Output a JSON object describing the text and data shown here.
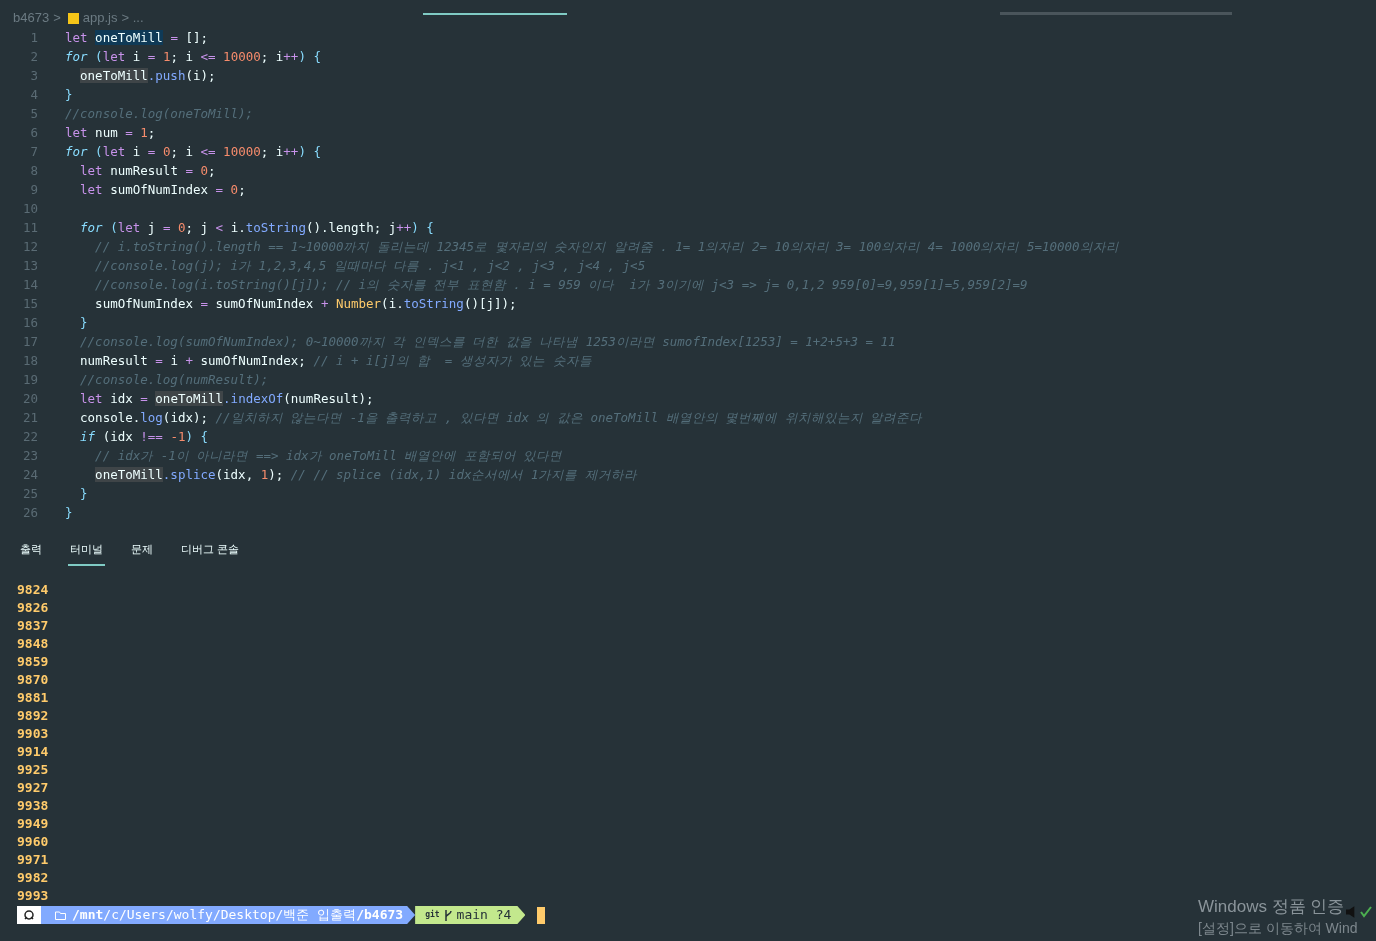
{
  "breadcrumb": {
    "folder": "b4673",
    "separator": ">",
    "file": "app.js",
    "more": "> ..."
  },
  "editor": {
    "lines": [
      {
        "number": "1",
        "tokens": [
          {
            "text": "let",
            "kind": "k"
          },
          {
            "text": " oneToMill",
            "kind": "s"
          },
          {
            "text": " =",
            "kind": "o"
          },
          {
            "text": " [];",
            "kind": "v"
          }
        ]
      },
      {
        "number": "2",
        "tokens": [
          {
            "text": "for",
            "kind": "c"
          },
          {
            "text": " (",
            "kind": "p"
          },
          {
            "text": "let",
            "kind": "k"
          },
          {
            "text": " i ",
            "kind": "v"
          },
          {
            "text": "=",
            "kind": "o"
          },
          {
            "text": " 1",
            "kind": "n"
          },
          {
            "text": "; i ",
            "kind": "v"
          },
          {
            "text": "<=",
            "kind": "o"
          },
          {
            "text": " 10000",
            "kind": "n"
          },
          {
            "text": "; i",
            "kind": "v"
          },
          {
            "text": "++",
            "kind": "o"
          },
          {
            "text": ") {",
            "kind": "p"
          }
        ]
      },
      {
        "number": "3",
        "tokens": [
          {
            "text": "  oneToMill",
            "kind": "h"
          },
          {
            "text": ".push",
            "kind": "f"
          },
          {
            "text": "(i);",
            "kind": "v"
          }
        ]
      },
      {
        "number": "4",
        "tokens": [
          {
            "text": "}",
            "kind": "p"
          }
        ]
      },
      {
        "number": "5",
        "tokens": [
          {
            "text": "//console.log(oneToMill);",
            "kind": "m"
          }
        ]
      },
      {
        "number": "6",
        "tokens": [
          {
            "text": "let",
            "kind": "k"
          },
          {
            "text": " num ",
            "kind": "v"
          },
          {
            "text": "=",
            "kind": "o"
          },
          {
            "text": " 1",
            "kind": "n"
          },
          {
            "text": ";",
            "kind": "v"
          }
        ]
      },
      {
        "number": "7",
        "tokens": [
          {
            "text": "for",
            "kind": "c"
          },
          {
            "text": " (",
            "kind": "p"
          },
          {
            "text": "let",
            "kind": "k"
          },
          {
            "text": " i ",
            "kind": "v"
          },
          {
            "text": "=",
            "kind": "o"
          },
          {
            "text": " 0",
            "kind": "n"
          },
          {
            "text": "; i ",
            "kind": "v"
          },
          {
            "text": "<=",
            "kind": "o"
          },
          {
            "text": " 10000",
            "kind": "n"
          },
          {
            "text": "; i",
            "kind": "v"
          },
          {
            "text": "++",
            "kind": "o"
          },
          {
            "text": ") {",
            "kind": "p"
          }
        ]
      },
      {
        "number": "8",
        "tokens": [
          {
            "text": "  let",
            "kind": "k"
          },
          {
            "text": " numResult ",
            "kind": "v"
          },
          {
            "text": "=",
            "kind": "o"
          },
          {
            "text": " 0",
            "kind": "n"
          },
          {
            "text": ";",
            "kind": "v"
          }
        ]
      },
      {
        "number": "9",
        "tokens": [
          {
            "text": "  let",
            "kind": "k"
          },
          {
            "text": " sumOfNumIndex ",
            "kind": "v"
          },
          {
            "text": "=",
            "kind": "o"
          },
          {
            "text": " 0",
            "kind": "n"
          },
          {
            "text": ";",
            "kind": "v"
          }
        ]
      },
      {
        "number": "10"
      },
      {
        "number": "11",
        "tokens": [
          {
            "text": "  for",
            "kind": "c"
          },
          {
            "text": " (",
            "kind": "p"
          },
          {
            "text": "let",
            "kind": "k"
          },
          {
            "text": " j ",
            "kind": "v"
          },
          {
            "text": "=",
            "kind": "o"
          },
          {
            "text": " 0",
            "kind": "n"
          },
          {
            "text": "; j ",
            "kind": "v"
          },
          {
            "text": "<",
            "kind": "o"
          },
          {
            "text": " i.",
            "kind": "v"
          },
          {
            "text": "toString",
            "kind": "f"
          },
          {
            "text": "().length; j",
            "kind": "v"
          },
          {
            "text": "++",
            "kind": "o"
          },
          {
            "text": ") {",
            "kind": "p"
          }
        ]
      },
      {
        "number": "12",
        "tokens": [
          {
            "text": "    // i.toString().length == 1~10000까지 돌리는데 12345로 몇자리의 숫자인지 알려줌 . 1= 1의자리 2= 10의자리 3= 100의자리 4= 1000의자리 5=10000의자리",
            "kind": "m"
          }
        ]
      },
      {
        "number": "13",
        "tokens": [
          {
            "text": "    //console.log(j); i가 1,2,3,4,5 일때마다 다름 . j<1 , j<2 , j<3 , j<4 , j<5",
            "kind": "m"
          }
        ]
      },
      {
        "number": "14",
        "tokens": [
          {
            "text": "    //console.log(i.toString()[j]); // i의 숫자를 전부 표현함 . i = 959 이다  i가 3이기에 j<3 => j= 0,1,2 959[0]=9,959[1]=5,959[2]=9",
            "kind": "m"
          }
        ]
      },
      {
        "number": "15",
        "tokens": [
          {
            "text": "    sumOfNumIndex ",
            "kind": "v"
          },
          {
            "text": "=",
            "kind": "o"
          },
          {
            "text": " sumOfNumIndex ",
            "kind": "v"
          },
          {
            "text": "+",
            "kind": "o"
          },
          {
            "text": " Number",
            "kind": "t"
          },
          {
            "text": "(i.",
            "kind": "v"
          },
          {
            "text": "toString",
            "kind": "f"
          },
          {
            "text": "()[j]);",
            "kind": "v"
          }
        ]
      },
      {
        "number": "16",
        "tokens": [
          {
            "text": "  }",
            "kind": "p"
          }
        ]
      },
      {
        "number": "17",
        "tokens": [
          {
            "text": "  //console.log(sumOfNumIndex); 0~10000까지 각 인덱스를 더한 값을 나타냄 1253이라면 sumofIndex[1253] = 1+2+5+3 = 11",
            "kind": "m"
          }
        ]
      },
      {
        "number": "18",
        "tokens": [
          {
            "text": "  numResult ",
            "kind": "v"
          },
          {
            "text": "=",
            "kind": "o"
          },
          {
            "text": " i ",
            "kind": "v"
          },
          {
            "text": "+",
            "kind": "o"
          },
          {
            "text": " sumOfNumIndex;",
            "kind": "v"
          },
          {
            "text": " // i + i[j]의 합  = 생성자가 있는 숫자들",
            "kind": "m"
          }
        ]
      },
      {
        "number": "19",
        "tokens": [
          {
            "text": "  //console.log(numResult);",
            "kind": "m"
          }
        ]
      },
      {
        "number": "20",
        "tokens": [
          {
            "text": "  let",
            "kind": "k"
          },
          {
            "text": " idx ",
            "kind": "v"
          },
          {
            "text": "=",
            "kind": "o"
          },
          {
            "text": " oneToMill",
            "kind": "h"
          },
          {
            "text": ".indexOf",
            "kind": "f"
          },
          {
            "text": "(numResult);",
            "kind": "v"
          }
        ]
      },
      {
        "number": "21",
        "tokens": [
          {
            "text": "  console.",
            "kind": "v"
          },
          {
            "text": "log",
            "kind": "f"
          },
          {
            "text": "(idx);",
            "kind": "v"
          },
          {
            "text": " //일치하지 않는다면 -1을 출력하고 , 있다면 idx 의 값은 oneToMill 배열안의 몇번째에 위치해있는지 알려준다",
            "kind": "m"
          }
        ]
      },
      {
        "number": "22",
        "tokens": [
          {
            "text": "  if",
            "kind": "c"
          },
          {
            "text": " (idx ",
            "kind": "v"
          },
          {
            "text": "!==",
            "kind": "o"
          },
          {
            "text": " -1",
            "kind": "n"
          },
          {
            "text": ") {",
            "kind": "p"
          }
        ]
      },
      {
        "number": "23",
        "tokens": [
          {
            "text": "    // idx가 -1이 아니라면 ==> idx가 oneToMill 배열안에 포함되어 있다면",
            "kind": "m"
          }
        ]
      },
      {
        "number": "24",
        "tokens": [
          {
            "text": "    oneToMill",
            "kind": "h"
          },
          {
            "text": ".splice",
            "kind": "f"
          },
          {
            "text": "(idx, ",
            "kind": "v"
          },
          {
            "text": "1",
            "kind": "n"
          },
          {
            "text": ");",
            "kind": "v"
          },
          {
            "text": " // // splice (idx,1) idx순서에서 1가지를 제거하라",
            "kind": "m"
          }
        ]
      },
      {
        "number": "25",
        "tokens": [
          {
            "text": "  }",
            "kind": "p"
          }
        ]
      },
      {
        "number": "26",
        "tokens": [
          {
            "text": "}",
            "kind": "p"
          }
        ]
      }
    ]
  },
  "panel": {
    "tabs": [
      {
        "label": "출력",
        "selected": false
      },
      {
        "label": "터미널",
        "selected": true
      },
      {
        "label": "문제",
        "selected": false
      },
      {
        "label": "디버그 콘솔",
        "selected": false
      }
    ],
    "output": [
      "9824",
      "9826",
      "9837",
      "9848",
      "9859",
      "9870",
      "9881",
      "9892",
      "9903",
      "9914",
      "9925",
      "9927",
      "9938",
      "9949",
      "9960",
      "9971",
      "9982",
      "9993"
    ],
    "prompt": {
      "path": "**/mnt**/c/Users/wolfy/Desktop/백준 입출력**/b4673**",
      "git_label": "git",
      "branch": "main ?4"
    }
  },
  "activation_notice": {
    "title": "Windows 정품 인증",
    "message": "[설정]으로 이동하여 Wind"
  }
}
